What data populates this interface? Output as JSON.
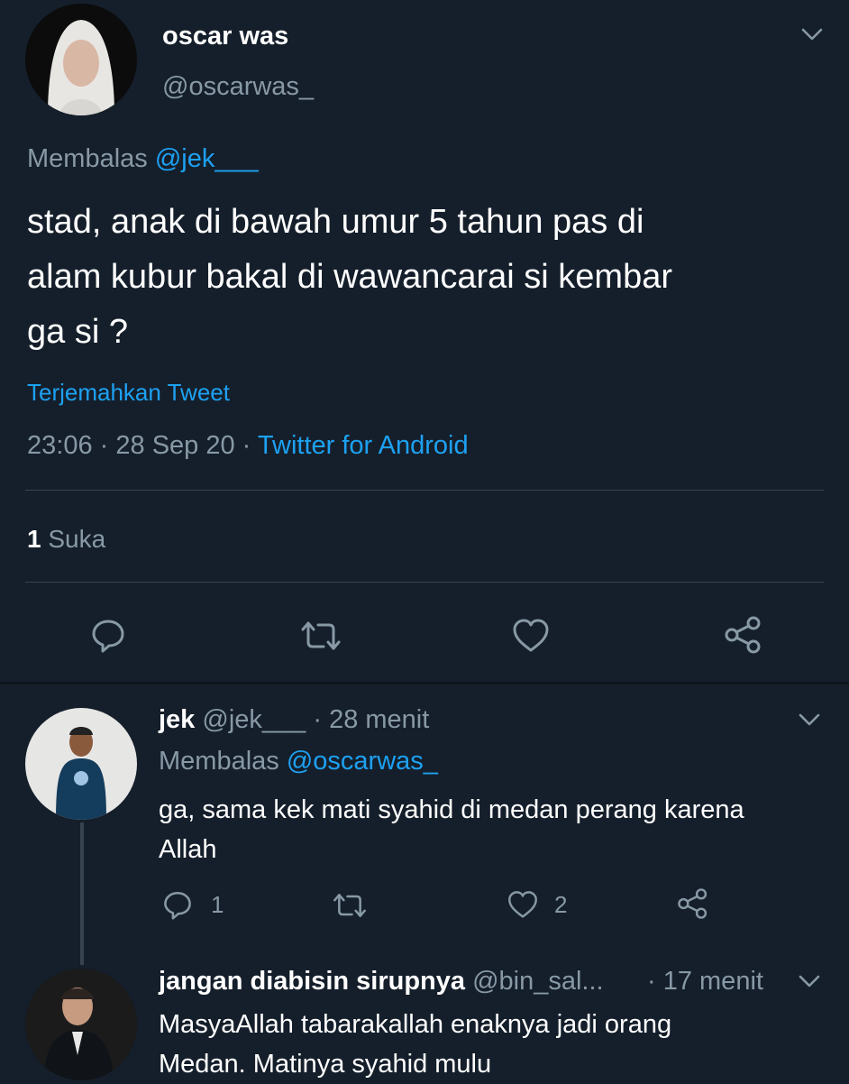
{
  "tweet": {
    "display_name": "oscar was",
    "handle": "@oscarwas_",
    "reply_prefix": "Membalas",
    "reply_to": "@jek___",
    "text_lines": [
      "stad, anak di bawah umur 5 tahun pas di",
      "alam kubur bakal di wawancarai si kembar",
      "ga si ?"
    ],
    "translate": "Terjemahkan Tweet",
    "time": "23:06",
    "date": "28 Sep 20",
    "client": "Twitter for Android",
    "sep": "·",
    "likes_count": "1",
    "likes_label": "Suka"
  },
  "replies": [
    {
      "display_name": "jek",
      "handle": "@jek___",
      "time": "· 28 menit",
      "reply_prefix": "Membalas",
      "reply_to": "@oscarwas_",
      "text_lines": [
        "ga, sama kek mati syahid di medan perang karena",
        "Allah"
      ],
      "reply_count": "1",
      "like_count": "2"
    },
    {
      "display_name": "jangan diabisin sirupnya",
      "handle": "@bin_sal...",
      "time": "· 17 menit",
      "text_lines": [
        "MasyaAllah tabarakallah enaknya jadi orang",
        "Medan. Matinya syahid mulu"
      ]
    }
  ],
  "colors": {
    "background": "#151f2b",
    "text": "#ffffff",
    "muted": "#8899a6",
    "link": "#1da1f2"
  }
}
